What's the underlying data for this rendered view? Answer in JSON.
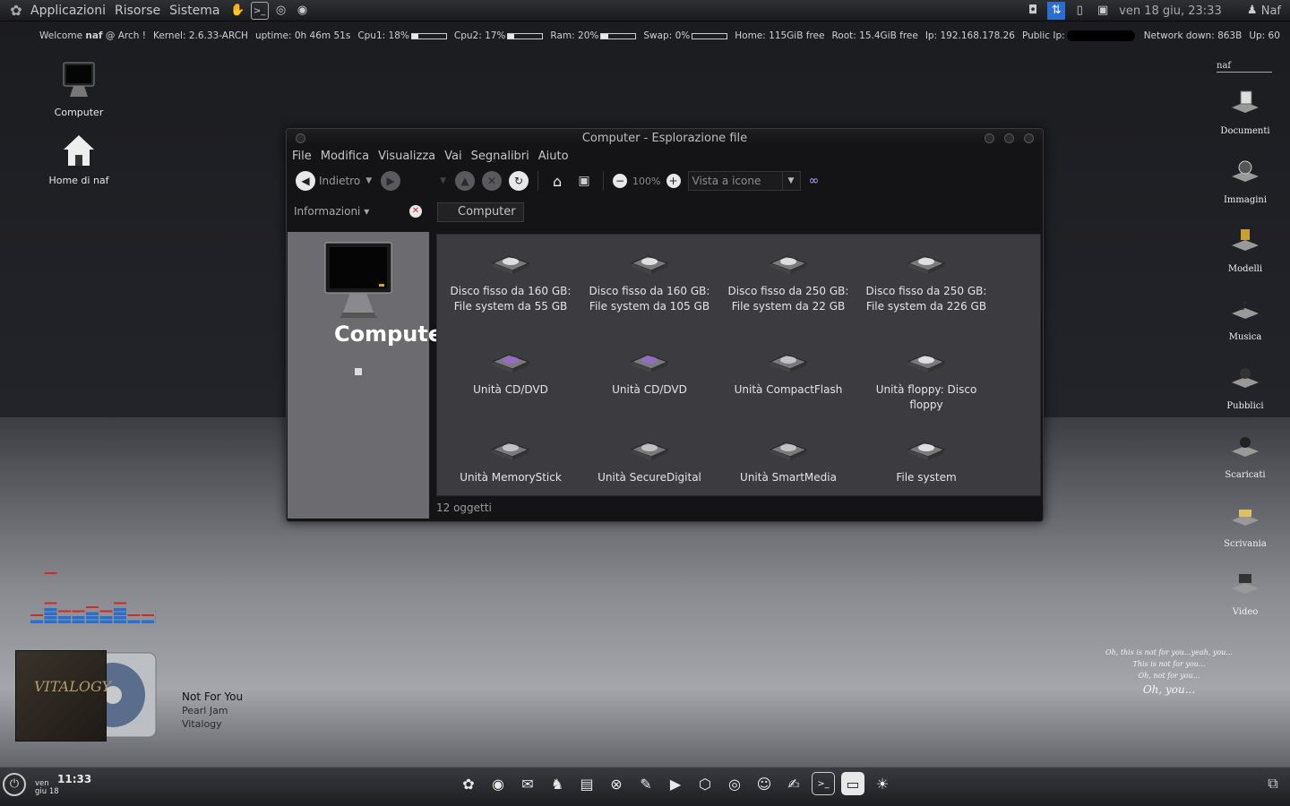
{
  "top_panel": {
    "menus": [
      "Applicazioni",
      "Risorse",
      "Sistema"
    ],
    "clock": "ven 18 giu, 23:33",
    "user": "Naf"
  },
  "conky": {
    "welcome_prefix": "Welcome",
    "user": "naf",
    "host": "@ Arch !",
    "kernel": "Kernel: 2.6.33-ARCH",
    "uptime": "uptime: 0h 46m 51s",
    "cpu1": "Cpu1: 18%",
    "cpu1_value": 18,
    "cpu2": "Cpu2: 17%",
    "cpu2_value": 17,
    "ram": "Ram: 20%",
    "ram_value": 20,
    "swap": "Swap: 0%",
    "swap_value": 0,
    "home": "Home: 115GiB free",
    "root": "Root: 15.4GiB free",
    "ip": "Ip: 192.168.178.26",
    "public_ip": "Public Ip:",
    "net_down": "Network down: 863B",
    "net_up": "Up: 60"
  },
  "desktop_icons": {
    "computer": "Computer",
    "home": "Home di naf"
  },
  "shelf": {
    "title": "naf",
    "items": [
      "Documenti",
      "Immagini",
      "Modelli",
      "Musica",
      "Pubblici",
      "Scaricati",
      "Scrivania",
      "Video"
    ]
  },
  "window": {
    "title": "Computer - Esplorazione file",
    "menus": [
      "File",
      "Modifica",
      "Visualizza",
      "Vai",
      "Segnalibri",
      "Aiuto"
    ],
    "toolbar": {
      "back": "Indietro",
      "zoom": "100%",
      "view_mode": "Vista a icone"
    },
    "side_pane_label": "Informazioni",
    "breadcrumb": "Computer",
    "side_title": "Compute",
    "items": [
      "Disco fisso da 160 GB: File system da 55 GB",
      "Disco fisso da 160 GB: File system da 105 GB",
      "Disco fisso da 250 GB: File system da 22 GB",
      "Disco fisso da 250 GB: File system da 226 GB",
      "Unità CD/DVD",
      "Unità CD/DVD",
      "Unità CompactFlash",
      "Unità floppy: Disco floppy",
      "Unità MemoryStick",
      "Unità SecureDigital",
      "Unità SmartMedia",
      "File system"
    ],
    "status": "12 oggetti"
  },
  "music": {
    "title": "Not For You",
    "artist": "Pearl Jam",
    "album": "Vitalogy",
    "cover_text": "VITALOGY"
  },
  "quote": {
    "line1": "Oh, this is not for you...yeah, you...",
    "line2": "This is not for you...",
    "line3": "Oh, not for you...",
    "line4": "Oh, you..."
  },
  "dock": {
    "day": "ven",
    "date": "giu 18",
    "time": "11:33"
  },
  "colors": {
    "accent_blue": "#2a6fd0",
    "eq_red": "#d02a2a"
  }
}
